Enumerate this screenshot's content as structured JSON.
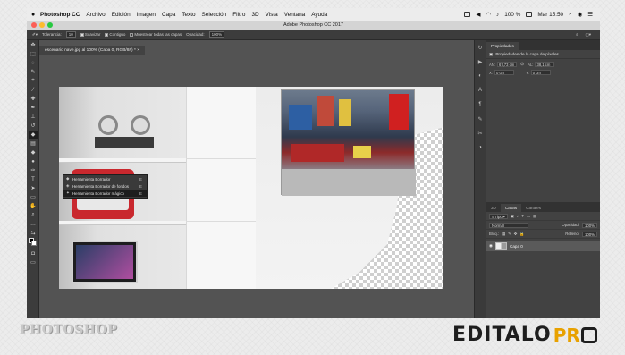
{
  "menubar": {
    "app": "Photoshop CC",
    "items": [
      "Archivo",
      "Edición",
      "Imagen",
      "Capa",
      "Texto",
      "Selección",
      "Filtro",
      "3D",
      "Vista",
      "Ventana",
      "Ayuda"
    ],
    "battery": "100 %",
    "clock": "Mar 15:50"
  },
  "window": {
    "title": "Adobe Photoshop CC 2017"
  },
  "options": {
    "tolerance_label": "Tolerancia:",
    "tolerance_value": "10",
    "smooth": "Suavizar",
    "contiguous": "Contiguo",
    "sample_all": "Muestrear todas las capas",
    "opacity_label": "Opacidad:",
    "opacity_value": "100%"
  },
  "document": {
    "tab": "escenario nave.jpg al 100% (Capa 0, RGB/8#) *"
  },
  "flyout": {
    "items": [
      {
        "label": "Herramienta Borrador",
        "key": "E"
      },
      {
        "label": "Herramienta Borrador de fondos",
        "key": "E"
      },
      {
        "label": "Herramienta Borrador mágico",
        "key": "E"
      }
    ]
  },
  "properties": {
    "tab": "Propiedades",
    "heading": "Propiedades de la capa de píxeles",
    "an_label": "AN:",
    "an_value": "67,73 cm",
    "al_label": "AL:",
    "al_value": "38,1 cm",
    "x_label": "X:",
    "x_value": "0 cm",
    "y_label": "Y:",
    "y_value": "0 cm"
  },
  "layers": {
    "tabs": [
      "3D",
      "Capas",
      "Canales"
    ],
    "kind": "Tipo",
    "blend": "Normal",
    "opacity_label": "Opacidad:",
    "opacity_value": "100%",
    "lock_label": "Bloq.:",
    "fill_label": "Relleno:",
    "fill_value": "100%",
    "layer_name": "Capa 0"
  },
  "branding": {
    "left": "PHOTOSHOP",
    "right_a": "EDITALO",
    "right_b": "PR"
  }
}
